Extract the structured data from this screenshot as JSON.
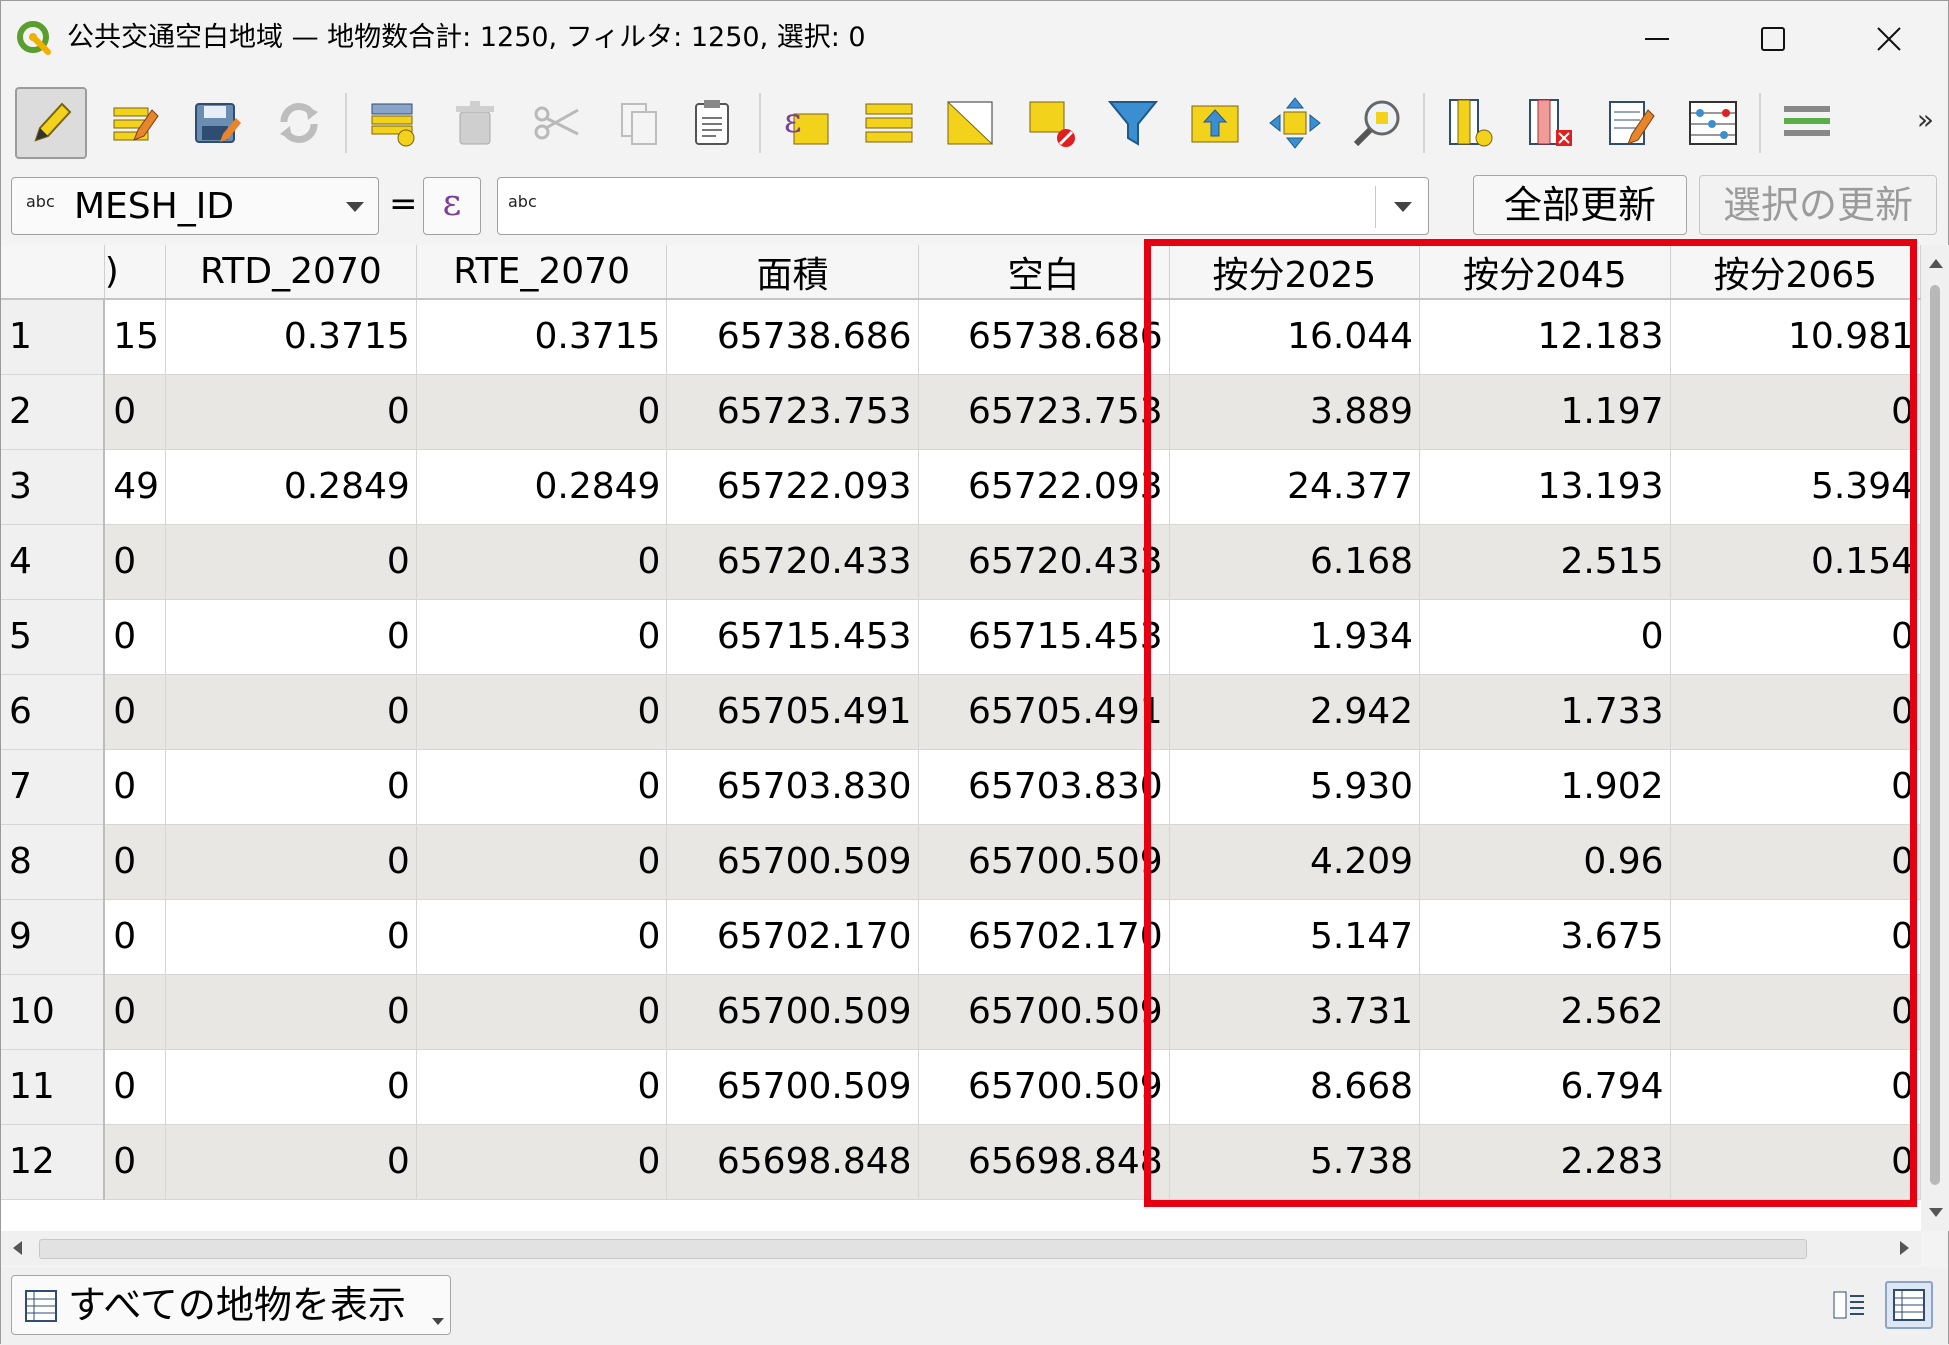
{
  "window": {
    "title": "公共交通空白地域 — 地物数合計: 1250, フィルタ: 1250, 選択: 0",
    "controls": [
      "minimize",
      "maximize",
      "close"
    ]
  },
  "toolbar": {
    "icons": [
      "toggle-editing-icon",
      "multi-edit-icon",
      "save-edits-icon",
      "reload-icon",
      "add-feature-icon",
      "delete-feature-icon",
      "cut-icon",
      "copy-icon",
      "paste-icon",
      "select-by-expression-icon",
      "select-all-icon",
      "invert-selection-icon",
      "deselect-all-icon",
      "filter-select-icon",
      "move-selection-to-top-icon",
      "pan-to-selected-icon",
      "zoom-to-selected-icon",
      "new-field-icon",
      "delete-field-icon",
      "conditional-formatting-icon",
      "field-calculator-icon",
      "actions-icon"
    ],
    "more": "»"
  },
  "calc": {
    "abc": "abc",
    "field": "MESH_ID",
    "equals": "=",
    "epsilon": "ε",
    "expr_abc": "abc",
    "update_all": "全部更新",
    "update_selected": "選択の更新"
  },
  "table": {
    "columns": [
      "",
      "RTD_2070",
      "RTE_2070",
      "面積",
      "空白",
      "按分2025",
      "按分2045",
      "按分2065"
    ],
    "first_col_header": ")",
    "rows": [
      {
        "n": "1",
        "c0": "15",
        "c1": "0.3715",
        "c2": "0.3715",
        "c3": "65738.686",
        "c4": "65738.686",
        "c5": "16.044",
        "c6": "12.183",
        "c7": "10.981"
      },
      {
        "n": "2",
        "c0": "0",
        "c1": "0",
        "c2": "0",
        "c3": "65723.753",
        "c4": "65723.753",
        "c5": "3.889",
        "c6": "1.197",
        "c7": "0"
      },
      {
        "n": "3",
        "c0": "49",
        "c1": "0.2849",
        "c2": "0.2849",
        "c3": "65722.093",
        "c4": "65722.093",
        "c5": "24.377",
        "c6": "13.193",
        "c7": "5.394"
      },
      {
        "n": "4",
        "c0": "0",
        "c1": "0",
        "c2": "0",
        "c3": "65720.433",
        "c4": "65720.433",
        "c5": "6.168",
        "c6": "2.515",
        "c7": "0.154"
      },
      {
        "n": "5",
        "c0": "0",
        "c1": "0",
        "c2": "0",
        "c3": "65715.453",
        "c4": "65715.453",
        "c5": "1.934",
        "c6": "0",
        "c7": "0"
      },
      {
        "n": "6",
        "c0": "0",
        "c1": "0",
        "c2": "0",
        "c3": "65705.491",
        "c4": "65705.491",
        "c5": "2.942",
        "c6": "1.733",
        "c7": "0"
      },
      {
        "n": "7",
        "c0": "0",
        "c1": "0",
        "c2": "0",
        "c3": "65703.830",
        "c4": "65703.830",
        "c5": "5.930",
        "c6": "1.902",
        "c7": "0"
      },
      {
        "n": "8",
        "c0": "0",
        "c1": "0",
        "c2": "0",
        "c3": "65700.509",
        "c4": "65700.509",
        "c5": "4.209",
        "c6": "0.96",
        "c7": "0"
      },
      {
        "n": "9",
        "c0": "0",
        "c1": "0",
        "c2": "0",
        "c3": "65702.170",
        "c4": "65702.170",
        "c5": "5.147",
        "c6": "3.675",
        "c7": "0"
      },
      {
        "n": "10",
        "c0": "0",
        "c1": "0",
        "c2": "0",
        "c3": "65700.509",
        "c4": "65700.509",
        "c5": "3.731",
        "c6": "2.562",
        "c7": "0"
      },
      {
        "n": "11",
        "c0": "0",
        "c1": "0",
        "c2": "0",
        "c3": "65700.509",
        "c4": "65700.509",
        "c5": "8.668",
        "c6": "6.794",
        "c7": "0"
      },
      {
        "n": "12",
        "c0": "0",
        "c1": "0",
        "c2": "0",
        "c3": "65698.848",
        "c4": "65698.848",
        "c5": "5.738",
        "c6": "2.283",
        "c7": "0"
      }
    ]
  },
  "bottom": {
    "filter_label": "すべての地物を表示"
  },
  "colors": {
    "highlight": "#e50012",
    "even_row": "#e9e7e3",
    "edit_yellow": "#f2d21b"
  }
}
